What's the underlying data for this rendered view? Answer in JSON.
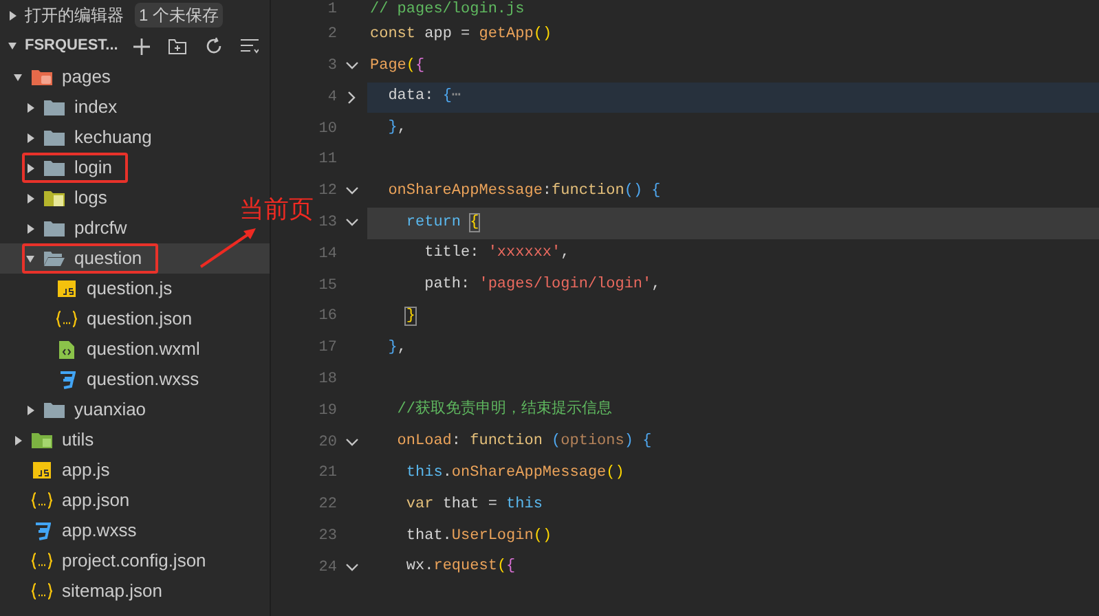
{
  "sidebar": {
    "open_editors": {
      "title": "打开的编辑器",
      "expanded": false,
      "badge": "1 个未保存"
    },
    "project": {
      "title": "FSRQUEST...",
      "expanded": true
    },
    "tree": [
      {
        "label": "pages",
        "kind": "pages-folder",
        "expanded": true,
        "selected": false,
        "children": [
          {
            "label": "index",
            "kind": "folder",
            "expanded": false,
            "selected": false
          },
          {
            "label": "kechuang",
            "kind": "folder",
            "expanded": false,
            "selected": false
          },
          {
            "label": "login",
            "kind": "folder",
            "expanded": false,
            "selected": false,
            "annotated": true
          },
          {
            "label": "logs",
            "kind": "logs-folder",
            "expanded": false,
            "selected": false
          },
          {
            "label": "pdrcfw",
            "kind": "folder",
            "expanded": false,
            "selected": false
          },
          {
            "label": "question",
            "kind": "folder",
            "expanded": true,
            "selected": true,
            "annotated": true,
            "children": [
              {
                "label": "question.js",
                "kind": "js",
                "selected": false
              },
              {
                "label": "question.json",
                "kind": "json",
                "selected": false
              },
              {
                "label": "question.wxml",
                "kind": "wxml",
                "selected": false
              },
              {
                "label": "question.wxss",
                "kind": "wxss",
                "selected": false
              }
            ]
          },
          {
            "label": "yuanxiao",
            "kind": "folder",
            "expanded": false,
            "selected": false
          }
        ]
      },
      {
        "label": "utils",
        "kind": "utils-folder",
        "expanded": false,
        "selected": false
      },
      {
        "label": "app.js",
        "kind": "js",
        "selected": false
      },
      {
        "label": "app.json",
        "kind": "json",
        "selected": false
      },
      {
        "label": "app.wxss",
        "kind": "wxss",
        "selected": false
      },
      {
        "label": "project.config.json",
        "kind": "json",
        "selected": false
      },
      {
        "label": "sitemap.json",
        "kind": "json",
        "selected": false
      }
    ]
  },
  "annotation": {
    "label": "当前页"
  },
  "editor": {
    "lines": [
      {
        "number": "1",
        "tokens": [
          {
            "text": "// pages/login.js",
            "kind": "comment"
          }
        ]
      },
      {
        "number": "2",
        "tokens": [
          {
            "text": "const",
            "kind": "keyword"
          },
          {
            "text": " app = ",
            "kind": "plain"
          },
          {
            "text": "getApp",
            "kind": "function"
          },
          {
            "text": "()",
            "kind": "bracket1"
          }
        ]
      },
      {
        "number": "3",
        "expanded": true,
        "tokens": [
          {
            "text": "Page",
            "kind": "function"
          },
          {
            "text": "(",
            "kind": "bracket1"
          },
          {
            "text": "{",
            "kind": "bracket2"
          }
        ]
      },
      {
        "number": "4",
        "expanded": false,
        "tokens": [
          {
            "text": "  data: ",
            "kind": "plain"
          },
          {
            "text": "{",
            "kind": "bracket3"
          },
          {
            "text": "⋯",
            "kind": "ellipsis"
          }
        ]
      },
      {
        "number": "10",
        "tokens": [
          {
            "text": "  }",
            "kind": "bracket3"
          },
          {
            "text": ",",
            "kind": "plain"
          }
        ]
      },
      {
        "number": "11"
      },
      {
        "number": "12",
        "expanded": true,
        "tokens": [
          {
            "text": "  onShareAppMessage",
            "kind": "function"
          },
          {
            "text": ":",
            "kind": "plain"
          },
          {
            "text": "function",
            "kind": "keyword"
          },
          {
            "text": "() {",
            "kind": "bracket3"
          }
        ]
      },
      {
        "number": "13",
        "expanded": true,
        "current": true,
        "tokens": [
          {
            "text": "    return ",
            "kind": "control"
          },
          {
            "text": "{",
            "kind": "bracket1",
            "matched": true
          }
        ]
      },
      {
        "number": "14",
        "tokens": [
          {
            "text": "      title: ",
            "kind": "plain"
          },
          {
            "text": "'xxxxxx'",
            "kind": "string"
          },
          {
            "text": ",",
            "kind": "plain"
          }
        ]
      },
      {
        "number": "15",
        "tokens": [
          {
            "text": "      path: ",
            "kind": "plain"
          },
          {
            "text": "'pages/login/login'",
            "kind": "string"
          },
          {
            "text": ",",
            "kind": "plain"
          }
        ]
      },
      {
        "number": "16",
        "tokens": [
          {
            "text": "    }",
            "kind": "bracket1",
            "matched": true
          }
        ]
      },
      {
        "number": "17",
        "tokens": [
          {
            "text": "  }",
            "kind": "bracket3"
          },
          {
            "text": ",",
            "kind": "plain"
          }
        ]
      },
      {
        "number": "18"
      },
      {
        "number": "19",
        "tokens": [
          {
            "text": "   //获取免责申明，结束提示信息",
            "kind": "comment"
          }
        ]
      },
      {
        "number": "20",
        "expanded": true,
        "tokens": [
          {
            "text": "   onLoad",
            "kind": "function"
          },
          {
            "text": ": ",
            "kind": "plain"
          },
          {
            "text": "function ",
            "kind": "keyword"
          },
          {
            "text": "(",
            "kind": "bracket3"
          },
          {
            "text": "options",
            "kind": "param"
          },
          {
            "text": ") {",
            "kind": "bracket3"
          }
        ]
      },
      {
        "number": "21",
        "tokens": [
          {
            "text": "    this",
            "kind": "control"
          },
          {
            "text": ".",
            "kind": "plain"
          },
          {
            "text": "onShareAppMessage",
            "kind": "function"
          },
          {
            "text": "()",
            "kind": "bracket1"
          }
        ]
      },
      {
        "number": "22",
        "tokens": [
          {
            "text": "    var",
            "kind": "keyword"
          },
          {
            "text": " that = ",
            "kind": "plain"
          },
          {
            "text": "this",
            "kind": "control"
          }
        ]
      },
      {
        "number": "23",
        "tokens": [
          {
            "text": "    that.",
            "kind": "plain"
          },
          {
            "text": "UserLogin",
            "kind": "function"
          },
          {
            "text": "()",
            "kind": "bracket1"
          }
        ]
      },
      {
        "number": "24",
        "expanded": true,
        "tokens": [
          {
            "text": "    wx.",
            "kind": "plain"
          },
          {
            "text": "request",
            "kind": "function"
          },
          {
            "text": "(",
            "kind": "bracket1"
          },
          {
            "text": "{",
            "kind": "bracket2"
          }
        ]
      }
    ]
  }
}
